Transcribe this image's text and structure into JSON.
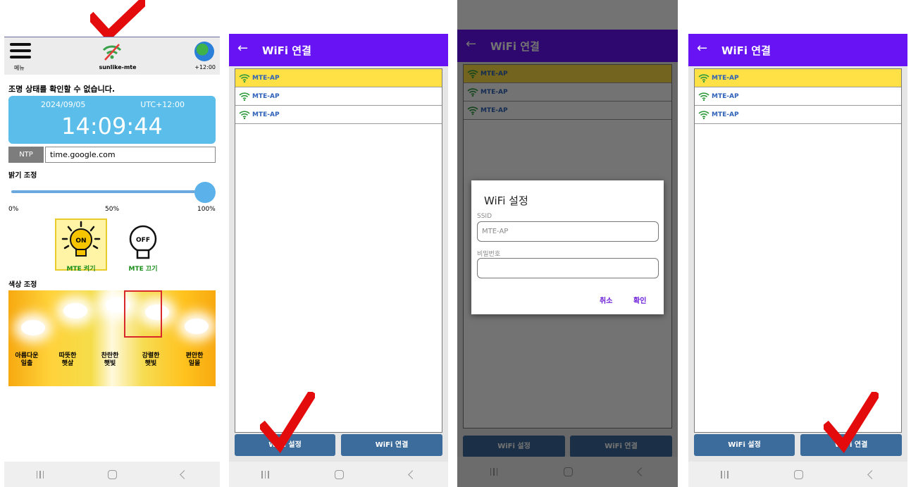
{
  "colors": {
    "purple": "#6713f3",
    "selected_row": "#ffe045",
    "button": "#3c6c9b",
    "sky": "#5bbde9",
    "check": "#e30b0b"
  },
  "screen1": {
    "menu_label": "메뉴",
    "device_name": "sunlike-mte",
    "timezone_badge": "+12:00",
    "status_text": "조명 상태를 확인할 수 없습니다.",
    "date": "2024/09/05",
    "utc": "UTC+12:00",
    "time": "14:09:44",
    "ntp_button": "NTP",
    "ntp_server": "time.google.com",
    "brightness_title": "밝기 조정",
    "brightness_percent": 100,
    "slider_labels": [
      "0%",
      "50%",
      "100%"
    ],
    "bulb_on_text": "ON",
    "bulb_off_text": "OFF",
    "on_label": "MTE 켜기",
    "off_label": "MTE 끄기",
    "color_title": "색상 조정",
    "presets": [
      {
        "line1": "아름다운",
        "line2": "일출"
      },
      {
        "line1": "따뜻한",
        "line2": "햇살"
      },
      {
        "line1": "찬란한",
        "line2": "햇빛"
      },
      {
        "line1": "강렬한",
        "line2": "햇빛"
      },
      {
        "line1": "편안한",
        "line2": "일몰"
      }
    ]
  },
  "wifi": {
    "title": "WiFi 연결",
    "networks": [
      "MTE-AP",
      "MTE-AP",
      "MTE-AP"
    ],
    "btn_settings": "WiFi 설정",
    "btn_connect": "WiFi 연결"
  },
  "dialog": {
    "title": "WiFi 설정",
    "ssid_label": "SSID",
    "ssid_value": "MTE-AP",
    "password_label": "비밀번호",
    "password_value": "",
    "cancel": "취소",
    "ok": "확인"
  }
}
